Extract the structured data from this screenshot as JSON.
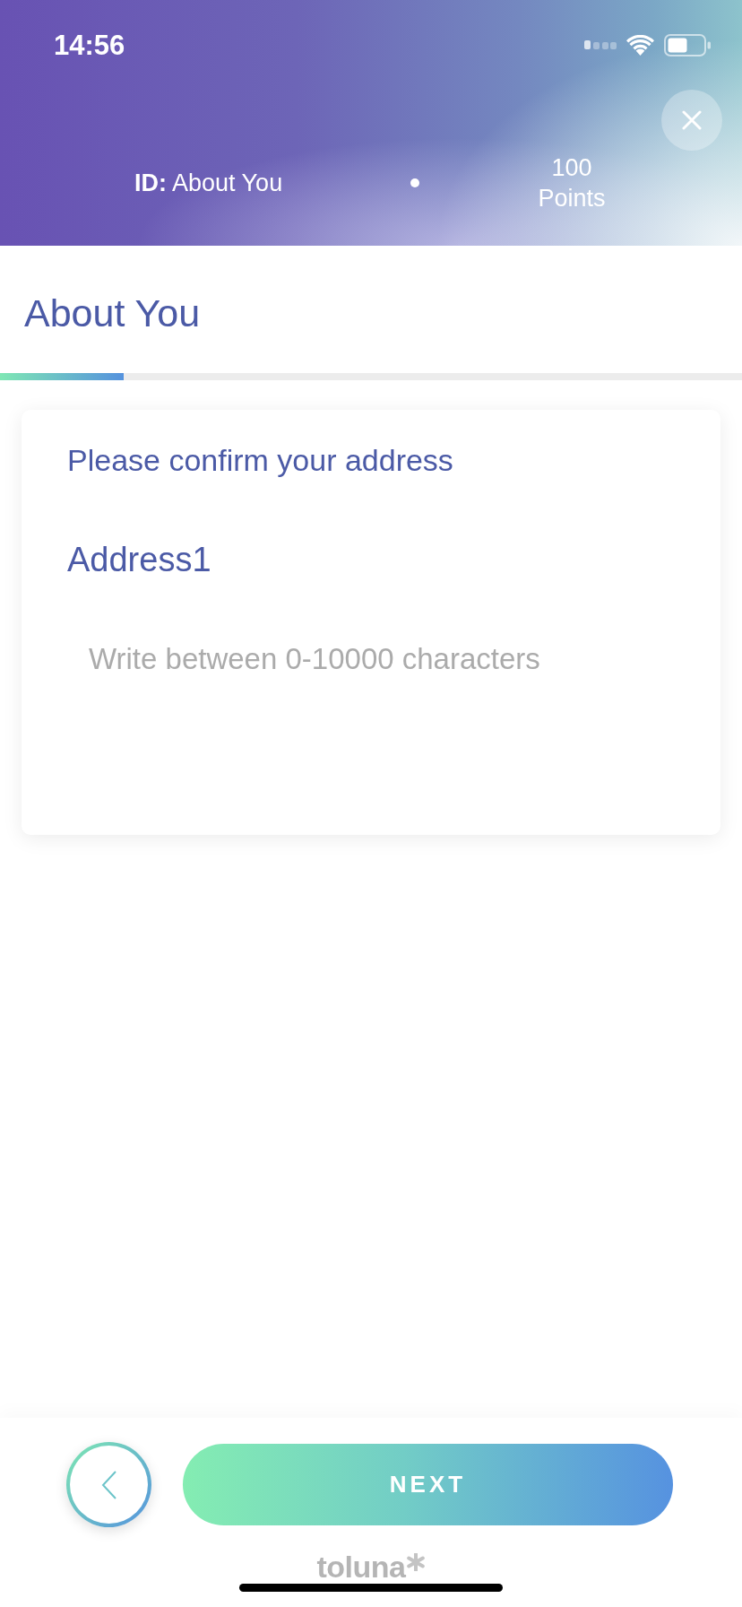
{
  "status_bar": {
    "time": "14:56"
  },
  "header": {
    "survey_id": "**ID:** About You",
    "points": "100",
    "points_label": "Points"
  },
  "page": {
    "title": "About You",
    "progress": {
      "level": 0.167
    }
  },
  "question": {
    "prompt": "Please confirm your address",
    "field_label": "Address1",
    "field": {
      "placeholder": "Write between 0-10000 characters"
    }
  },
  "footer": {
    "next_button": "NEXT",
    "brand": "toluna"
  }
}
